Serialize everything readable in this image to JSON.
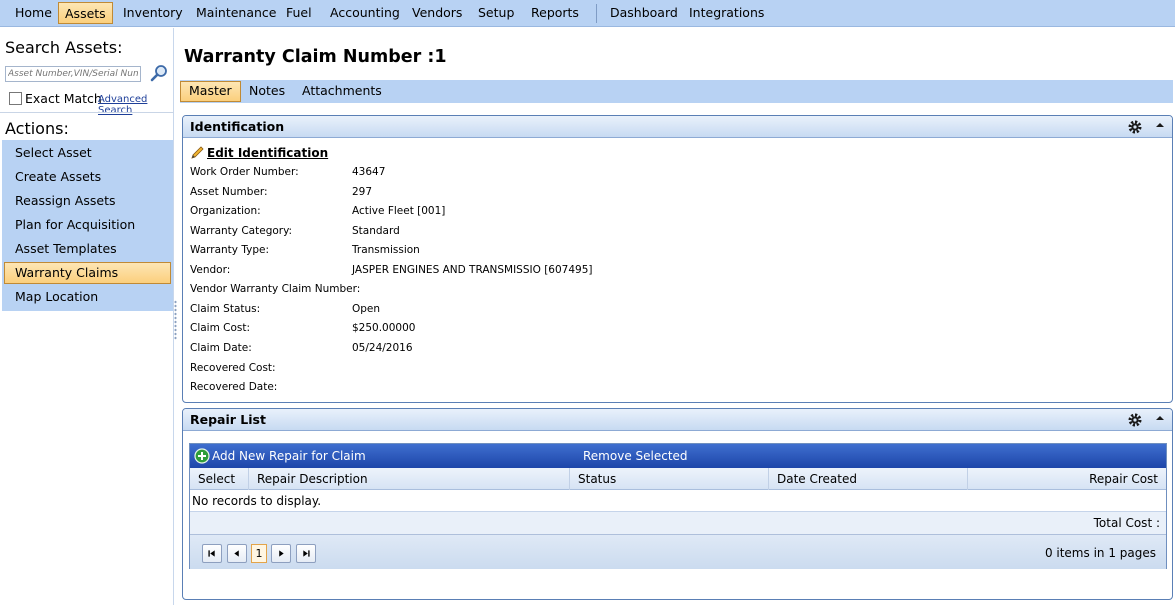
{
  "menu": {
    "items": [
      "Home",
      "Assets",
      "Inventory",
      "Maintenance",
      "Fuel",
      "Accounting",
      "Vendors",
      "Setup",
      "Reports",
      "Dashboard",
      "Integrations"
    ],
    "active": "Assets"
  },
  "sidebar": {
    "search_title": "Search Assets:",
    "search_placeholder": "Asset Number,VIN/Serial Number",
    "exact_match_label": "Exact Match",
    "advanced_search_label": "Advanced Search",
    "actions_title": "Actions:",
    "actions": [
      "Select Asset",
      "Create Assets",
      "Reassign Assets",
      "Plan for Acquisition",
      "Asset Templates",
      "Warranty Claims",
      "Map Location"
    ],
    "active_action": "Warranty Claims"
  },
  "page": {
    "title": "Warranty Claim Number :1",
    "tabs": [
      "Master",
      "Notes",
      "Attachments"
    ],
    "active_tab": "Master"
  },
  "identification": {
    "panel_title": "Identification",
    "edit_label": "Edit Identification",
    "fields": [
      {
        "label": "Work Order Number:",
        "value": "43647"
      },
      {
        "label": "Asset Number:",
        "value": "297"
      },
      {
        "label": "Organization:",
        "value": "Active Fleet [001]"
      },
      {
        "label": "Warranty Category:",
        "value": "Standard"
      },
      {
        "label": "Warranty Type:",
        "value": "Transmission"
      },
      {
        "label": "Vendor:",
        "value": "JASPER ENGINES AND TRANSMISSIO [607495]"
      },
      {
        "label": "Vendor Warranty Claim Number:",
        "value": ""
      },
      {
        "label": "Claim Status:",
        "value": "Open"
      },
      {
        "label": "Claim Cost:",
        "value": "$250.00000"
      },
      {
        "label": "Claim Date:",
        "value": "05/24/2016"
      },
      {
        "label": "Recovered Cost:",
        "value": ""
      },
      {
        "label": "Recovered Date:",
        "value": ""
      }
    ]
  },
  "repair_list": {
    "panel_title": "Repair List",
    "add_label": "Add New Repair for Claim",
    "remove_label": "Remove Selected",
    "columns": [
      "Select",
      "Repair Description",
      "Status",
      "Date Created",
      "Repair Cost"
    ],
    "empty_text": "No records to display.",
    "total_label": "Total Cost :",
    "current_page": "1",
    "pager_info": "0 items in 1 pages"
  },
  "colors": {
    "menu_bg": "#b8d2f3",
    "active_bg": "#fbcf7d",
    "grid_toolbar": "#1d45a9",
    "panel_border": "#5a7fb5"
  }
}
